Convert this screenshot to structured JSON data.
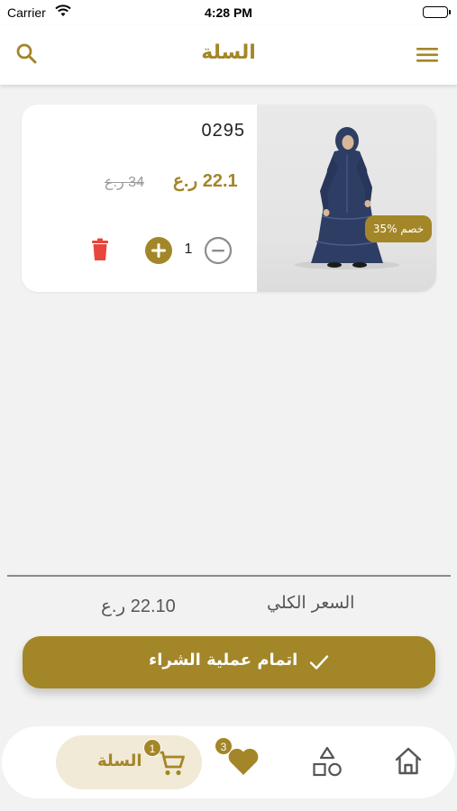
{
  "status_bar": {
    "carrier": "Carrier",
    "time": "4:28 PM"
  },
  "header": {
    "title": "السلة",
    "search_icon": "search-icon",
    "menu_icon": "hamburger-menu-icon"
  },
  "cart_items": [
    {
      "name": "0295",
      "price": "22.1 ر.ع",
      "old_price": "34 ر.ع",
      "discount_badge": "35% خصم",
      "quantity": "1"
    }
  ],
  "summary": {
    "total_label": "السعر الكلي",
    "total_value": "22.10 ر.ع"
  },
  "checkout": {
    "label": "اتمام عملية الشراء"
  },
  "bottom_nav": {
    "cart_label": "السلة",
    "cart_badge": "1",
    "favorites_badge": "3"
  },
  "colors": {
    "accent": "#a38628",
    "delete": "#e8453c",
    "cart_tab_bg": "#f1ead7"
  }
}
